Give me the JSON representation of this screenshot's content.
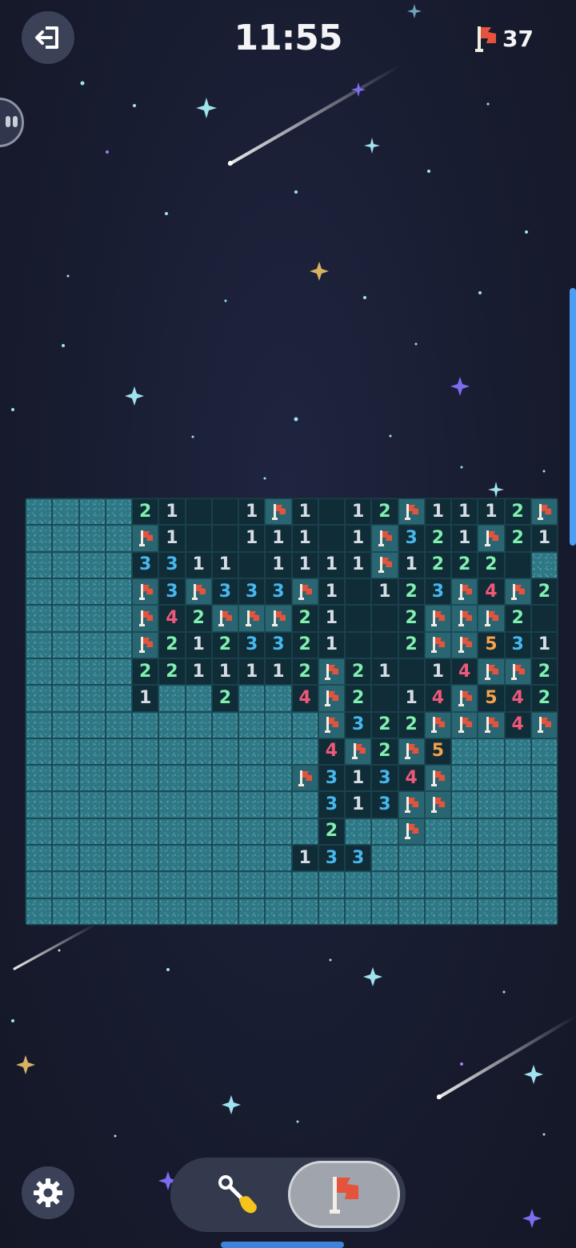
{
  "header": {
    "timer": "11:55",
    "flags_remaining": "37",
    "exit_icon": "exit-icon"
  },
  "board": {
    "columns": 20,
    "rows": 16,
    "legend": {
      "C": "covered",
      "F": "flag",
      ".": "open-empty",
      "1-5": "number"
    },
    "grid": [
      "CCCC21..1F1.12F1112F",
      "CCCCF1..111.1F321F21",
      "CCCC3311.1111F1222.",
      "CCCCF3F333F1.123F4F2.",
      "CCCCF42FFF21..2FFF2.",
      "CCCCF21233321..2FF531",
      "CCCC22111 2F21.14FF2F",
      "CCCC1CC2CC4F2.14F542",
      "CCCCCCCCCCCF322FFF4F",
      "CCCCCCCCCCC4F2F5CCCC",
      "CCCCCCCCCCF313 4FCCCC",
      "CCCCCCCCCCC313FFCCCC",
      "CCCCCCCCCCC2CCFCCCCC",
      "CCCCCCCCCC133CCCCCCC",
      "CCCCCCCCCCCCCCCCCCCC",
      "CCCCCCCCCCCCCCCCCCCC"
    ],
    "colors": {
      "n1": "#d6dde4",
      "n2": "#7ff0b0",
      "n3": "#45b8f0",
      "n4": "#f0587a",
      "n5": "#f7a14a",
      "flag": "#e5533d"
    }
  },
  "controls": {
    "settings_icon": "gear-icon",
    "modes": [
      "dig",
      "flag"
    ],
    "active_mode": "flag"
  }
}
